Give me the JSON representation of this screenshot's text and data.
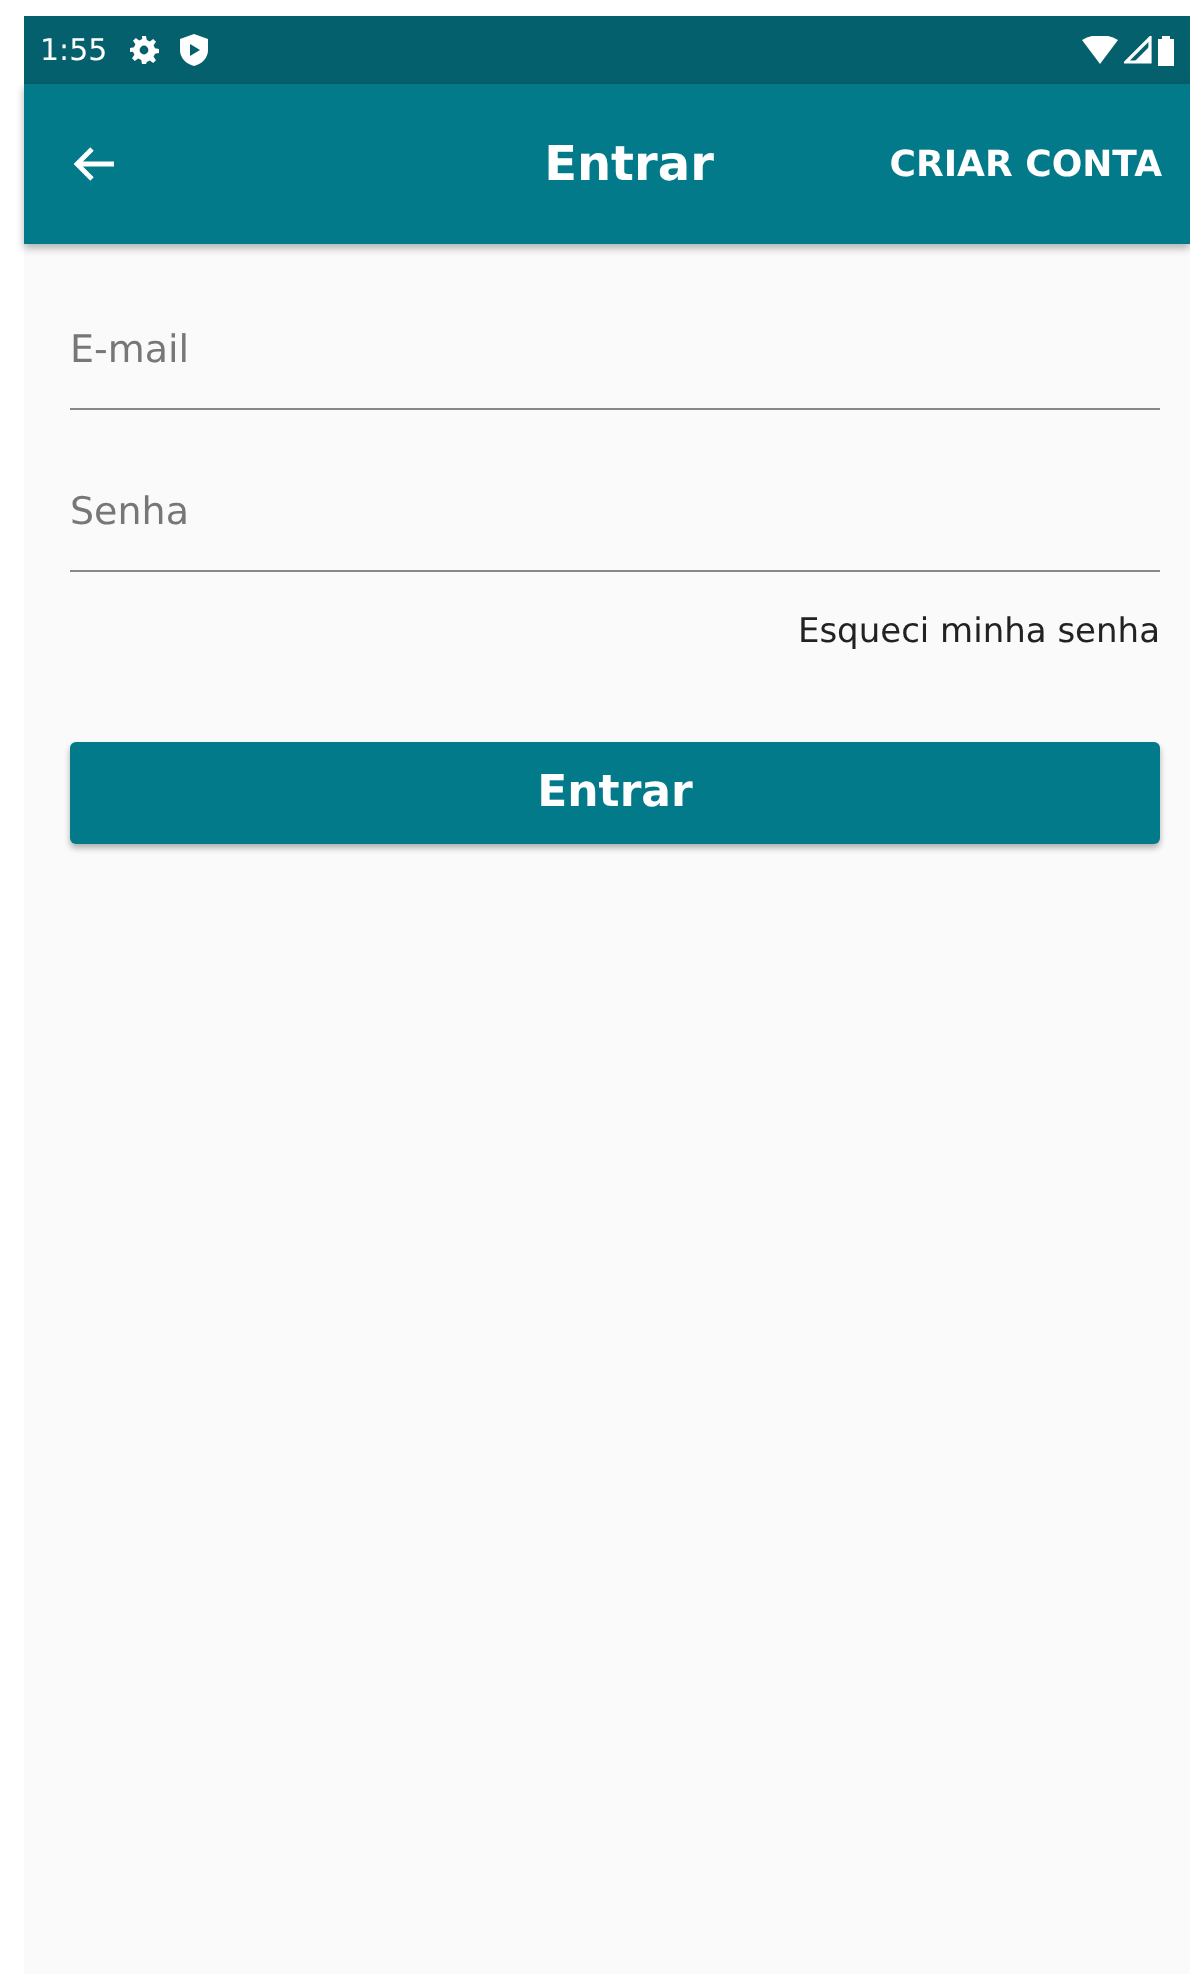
{
  "status_bar": {
    "time": "1:55"
  },
  "app_bar": {
    "title": "Entrar",
    "action": "CRIAR CONTA"
  },
  "form": {
    "fields": [
      {
        "placeholder": "E-mail"
      },
      {
        "placeholder": "Senha"
      }
    ],
    "forgot_link": "Esqueci minha senha",
    "submit": "Entrar"
  }
}
